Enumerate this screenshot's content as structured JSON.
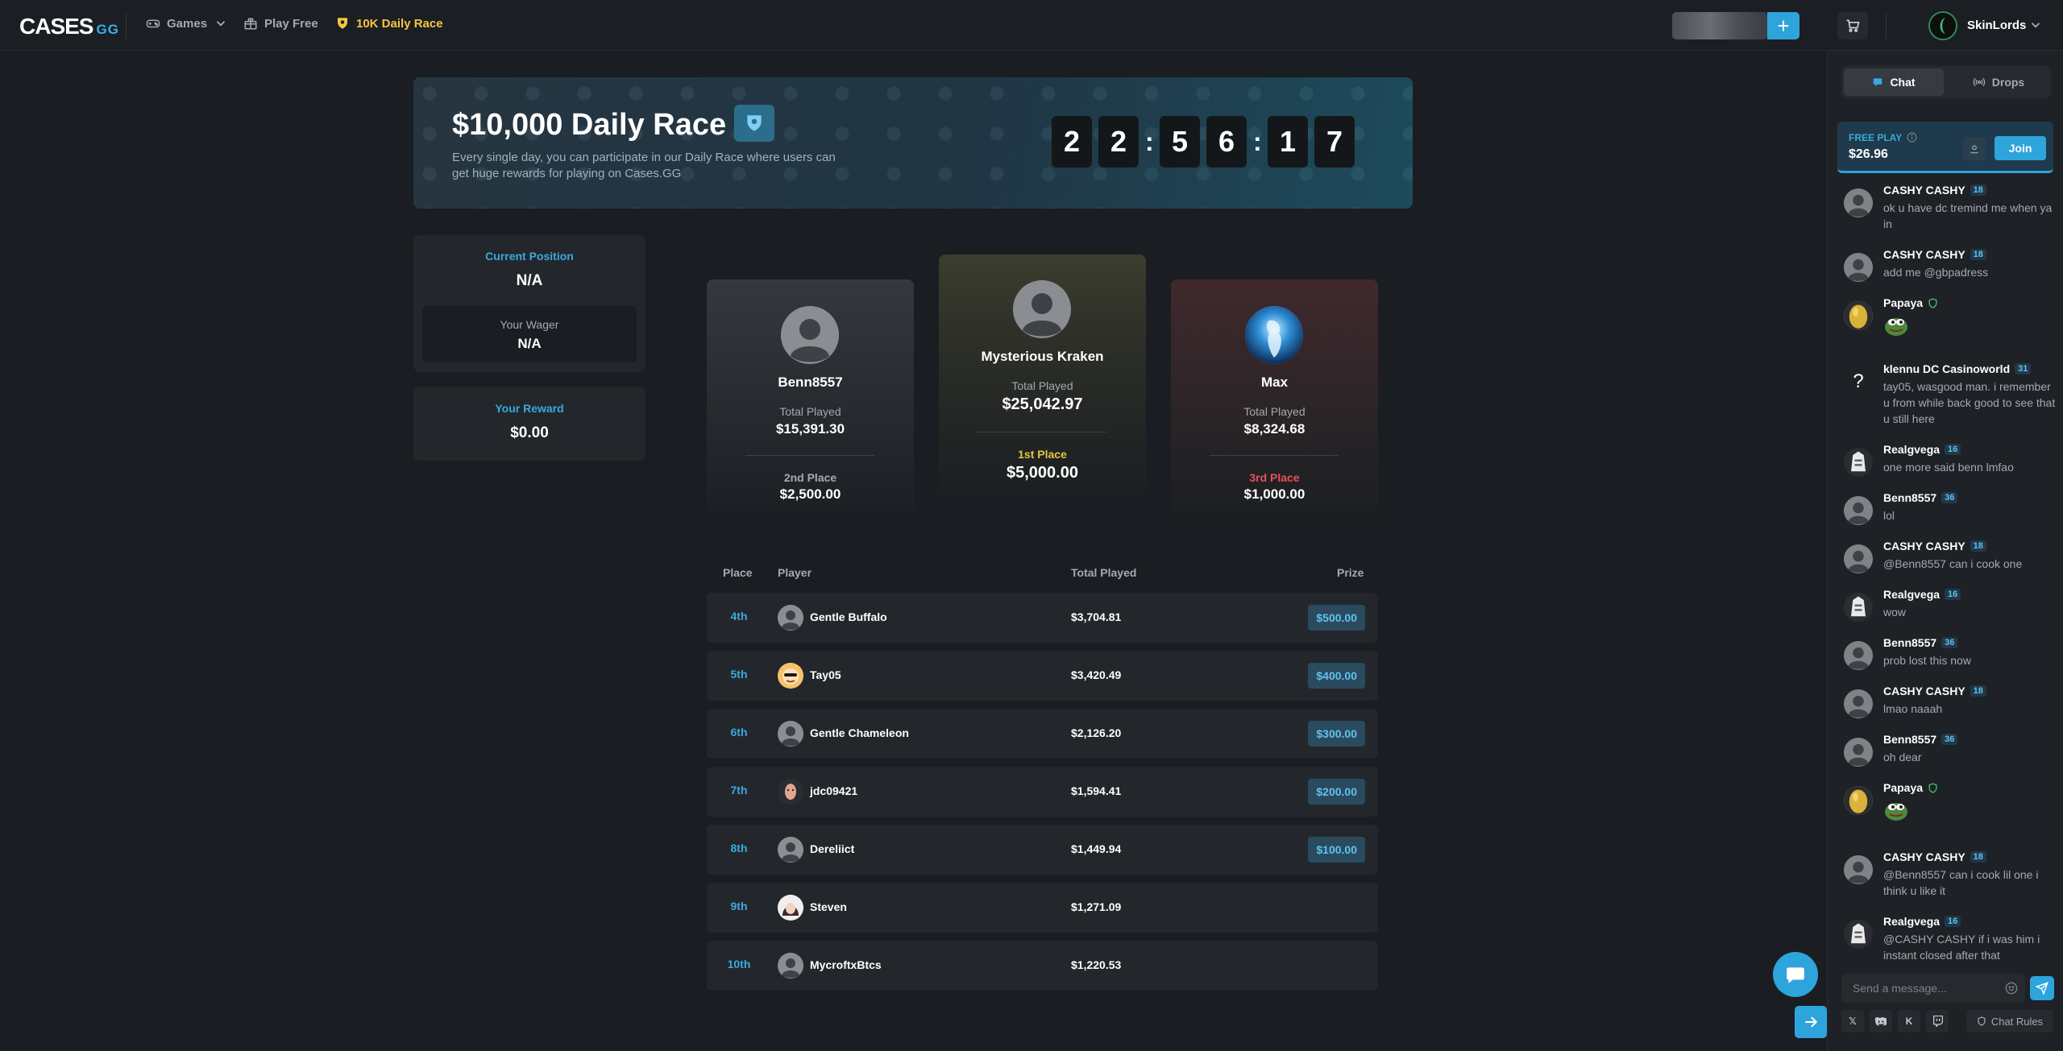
{
  "header": {
    "logo_main": "CASES",
    "logo_suffix": "GG",
    "nav": {
      "games": "Games",
      "play_free": "Play Free",
      "daily_race": "10K Daily Race"
    },
    "plus_icon": "+",
    "username": "SkinLords"
  },
  "banner": {
    "title": "$10,000 Daily Race",
    "description": "Every single day, you can participate in our Daily Race where users can get huge rewards for playing on Cases.GG",
    "countdown": [
      "2",
      "2",
      "5",
      "6",
      "1",
      "7"
    ]
  },
  "stats": {
    "current_position_label": "Current Position",
    "current_position_value": "N/A",
    "wager_label": "Your Wager",
    "wager_value": "N/A",
    "reward_label": "Your Reward",
    "reward_value": "$0.00"
  },
  "podium": {
    "total_played_label": "Total Played",
    "first": {
      "name": "Mysterious Kraken",
      "total": "$25,042.97",
      "place": "1st Place",
      "prize": "$5,000.00",
      "color": "#e5c93a"
    },
    "second": {
      "name": "Benn8557",
      "total": "$15,391.30",
      "place": "2nd Place",
      "prize": "$2,500.00",
      "color": "#a5aab0"
    },
    "third": {
      "name": "Max",
      "total": "$8,324.68",
      "place": "3rd Place",
      "prize": "$1,000.00",
      "color": "#e8505b"
    }
  },
  "table": {
    "headers": {
      "place": "Place",
      "player": "Player",
      "total": "Total Played",
      "prize": "Prize"
    },
    "rows": [
      {
        "place": "4th",
        "name": "Gentle Buffalo",
        "total": "$3,704.81",
        "prize": "$500.00"
      },
      {
        "place": "5th",
        "name": "Tay05",
        "total": "$3,420.49",
        "prize": "$400.00"
      },
      {
        "place": "6th",
        "name": "Gentle Chameleon",
        "total": "$2,126.20",
        "prize": "$300.00"
      },
      {
        "place": "7th",
        "name": "jdc09421",
        "total": "$1,594.41",
        "prize": "$200.00"
      },
      {
        "place": "8th",
        "name": "Dereliict",
        "total": "$1,449.94",
        "prize": "$100.00"
      },
      {
        "place": "9th",
        "name": "Steven",
        "total": "$1,271.09",
        "prize": ""
      },
      {
        "place": "10th",
        "name": "MycroftxBtcs",
        "total": "$1,220.53",
        "prize": ""
      }
    ]
  },
  "chat": {
    "tab_chat": "Chat",
    "tab_drops": "Drops",
    "freeplay_label": "FREE PLAY",
    "freeplay_amount": "$26.96",
    "join_label": "Join",
    "messages": [
      {
        "user": "CASHY CASHY",
        "level": "18",
        "text": "ok u have dc tremind me when ya in"
      },
      {
        "user": "CASHY CASHY",
        "level": "18",
        "text": "add me @gbpadress"
      },
      {
        "user": "Papaya",
        "level": "",
        "text": ""
      },
      {
        "user": "klennu DC Casinoworld",
        "level": "31",
        "text": "tay05, wasgood man. i remember u from while back good to see that u still here"
      },
      {
        "user": "Realgvega",
        "level": "16",
        "text": "one more said benn lmfao"
      },
      {
        "user": "Benn8557",
        "level": "36",
        "text": "lol"
      },
      {
        "user": "CASHY CASHY",
        "level": "18",
        "text": "@Benn8557 can i cook one"
      },
      {
        "user": "Realgvega",
        "level": "16",
        "text": "wow"
      },
      {
        "user": "Benn8557",
        "level": "36",
        "text": "prob lost this now"
      },
      {
        "user": "CASHY CASHY",
        "level": "18",
        "text": "lmao naaah"
      },
      {
        "user": "Benn8557",
        "level": "36",
        "text": "oh dear"
      },
      {
        "user": "Papaya",
        "level": "",
        "text": ""
      },
      {
        "user": "CASHY CASHY",
        "level": "18",
        "text": "@Benn8557 can i cook lil one i think u like it"
      },
      {
        "user": "Realgvega",
        "level": "16",
        "text": "@CASHY CASHY if i was him i instant closed after that"
      }
    ],
    "input_placeholder": "Send a message...",
    "rules_label": "Chat Rules"
  }
}
